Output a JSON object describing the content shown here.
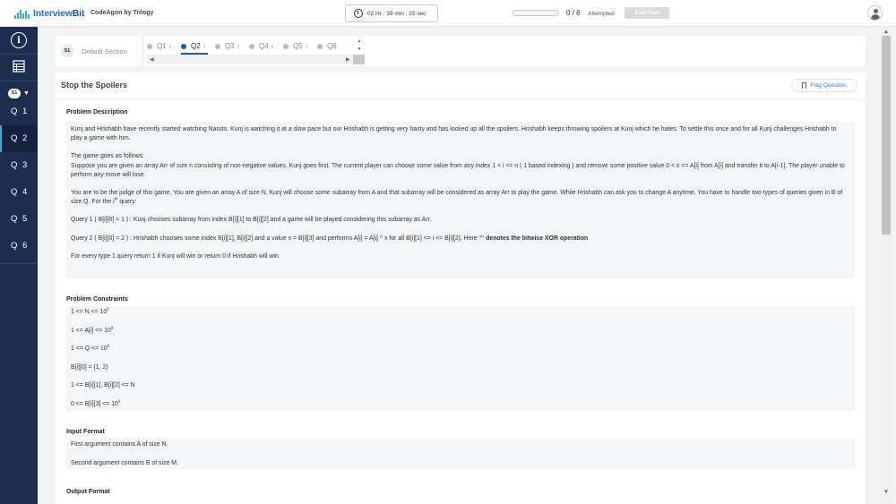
{
  "topbar": {
    "logo_text_a": "Interview",
    "logo_text_b": "Bit",
    "brand": "CodeAgon by Trilogy",
    "timer": "02 Hr : 39 min : 25 sec",
    "progress_fraction": 0,
    "attempt_count": "0 / 6",
    "attempt_label": "Attempted",
    "end_test": "End Test",
    "icons": {
      "timer": "clock-icon",
      "avatar": "user-avatar-icon"
    }
  },
  "sidebar": {
    "icons": [
      "info-icon",
      "list-icon"
    ],
    "section_pill": "S1",
    "questions": [
      "Q 1",
      "Q 2",
      "Q 3",
      "Q 4",
      "Q 5",
      "Q 6"
    ],
    "active_index": 1,
    "colors": {
      "bg": "#1c2d4f",
      "active_accent": "#3fa7d6"
    }
  },
  "section_bar": {
    "badge": "S1",
    "name": "Default Section",
    "tabs": [
      "Q1",
      "Q2",
      "Q3",
      "Q4",
      "Q5",
      "Q6"
    ],
    "active_tab": 1
  },
  "question": {
    "title": "Stop the Spoilers",
    "flag_label": "Flag Question",
    "problem_description_heading": "Problem Description",
    "desc_p1": "Kunj and Hrishabh have recently started watching Naruto. Kunj is watching it at a slow pace but our Hrishabh is getting very hasty and has looked up all the spoilers. Hrishabh keeps throwing spoilers at Kunj which he hates. To settle this once and for all Kunj challenges Hrishabh to play a game with him.",
    "desc_p2_l1": "The game goes as follows:",
    "desc_p2_l2": "Suppose you are given an array Arr of size n consisting of non-negative values. Kunj goes first. The current player can choose some value from any index 1 < i <= n ( 1 based indexing ) and remove some positive value 0 < x <= A[i] from A[i] and transfer it to A[i-1]. The player unable to perform any move will lose.",
    "desc_p3_a": "You are to be the judge of this game. You are given an array A of size N. Kunj will choose some subarray from A and that subarray will be considered as array Arr to play the game. While Hrishabh can ask you to change A anytime. You have to handle two types of queries given in B of size Q. For the i",
    "desc_p3_sup": "th",
    "desc_p3_b": " query:",
    "query1": "Query 1 ( B[i][0] = 1 ) : Kunj chooses subarray from index B[i][1] to B[i][2] and a game will be played considering this subarray as Arr.",
    "query2_a": "Query 2 ( B[i][0] = 2 ) : Hrishabh chooses some index B[i][1], B[i][2] and a value x = B[i][3] and performs A[i] = A[i] ^ x for all B[i][1] <= i <= B[i][2]. Here '^'",
    "query2_b": " denotes the bitwise XOR operation",
    "desc_last": "For every type 1 query return 1 if Kunj will win or return 0 if Hrishabh will win.",
    "constraints_heading": "Problem Constraints",
    "constraints": [
      {
        "text": "1 <= N <= 10",
        "sup": "5"
      },
      {
        "text": "1 <= A[i] <= 10",
        "sup": "9"
      },
      {
        "text": "1 <= Q <= 10",
        "sup": "5"
      },
      {
        "text": "B[i][0] = {1, 2}",
        "sup": ""
      },
      {
        "text": "1 <= B[i][1], B[i][2] <= N",
        "sup": ""
      },
      {
        "text": "0 <= B[i][3] <= 10",
        "sup": "9"
      }
    ],
    "input_heading": "Input Format",
    "input_l1": "First argument contains A of size N.",
    "input_l2": "Second argument contains B of size M.",
    "output_heading": "Output Format"
  }
}
